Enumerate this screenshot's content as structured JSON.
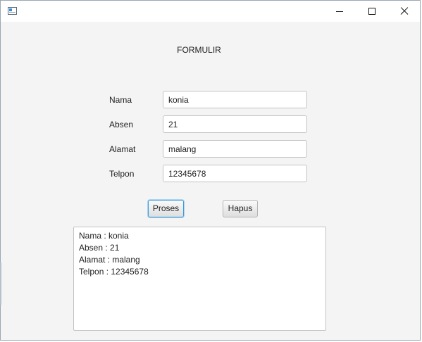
{
  "window": {
    "title": "",
    "icon": "app-window-icon"
  },
  "form": {
    "title": "FORMULIR",
    "fields": [
      {
        "label": "Nama",
        "value": "konia"
      },
      {
        "label": "Absen",
        "value": "21"
      },
      {
        "label": "Alamat",
        "value": "malang"
      },
      {
        "label": "Telpon",
        "value": "12345678"
      }
    ],
    "buttons": {
      "proses": "Proses",
      "hapus": "Hapus"
    },
    "output_lines": [
      "Nama : konia",
      "Absen : 21",
      "Alamat : malang",
      "Telpon : 12345678"
    ]
  },
  "colors": {
    "window_background": "#f4f4f4",
    "focus_border": "#3b9ad9"
  }
}
